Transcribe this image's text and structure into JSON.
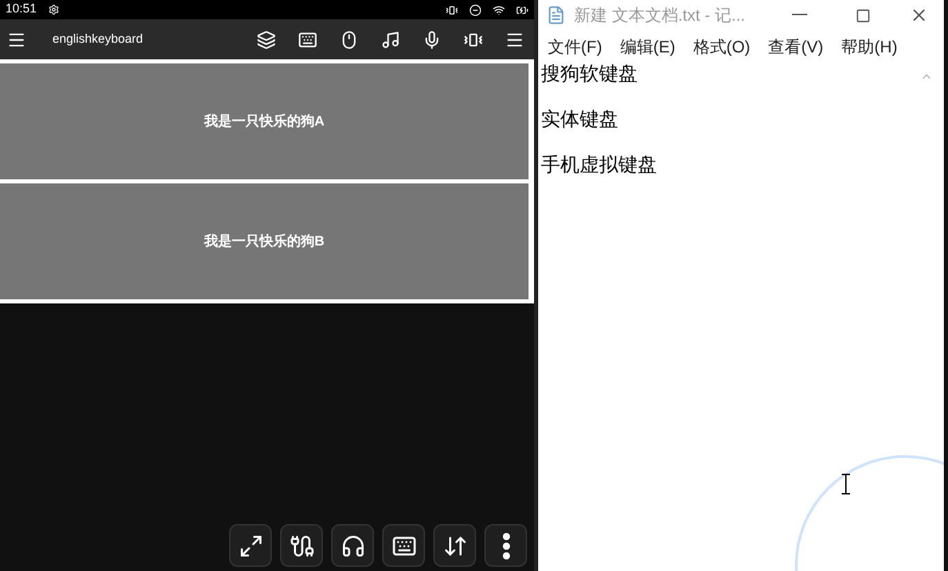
{
  "status_bar": {
    "time": "10:51"
  },
  "toolbar": {
    "title": "englishkeyboard"
  },
  "keys": [
    {
      "label": "我是一只快乐的狗A"
    },
    {
      "label": "我是一只快乐的狗B"
    }
  ],
  "notepad": {
    "title": "新建 文本文档.txt - 记...",
    "menu": [
      "文件(F)",
      "编辑(E)",
      "格式(O)",
      "查看(V)",
      "帮助(H)"
    ],
    "lines": [
      "搜狗软键盘",
      "实体键盘",
      "手机虚拟键盘"
    ]
  }
}
